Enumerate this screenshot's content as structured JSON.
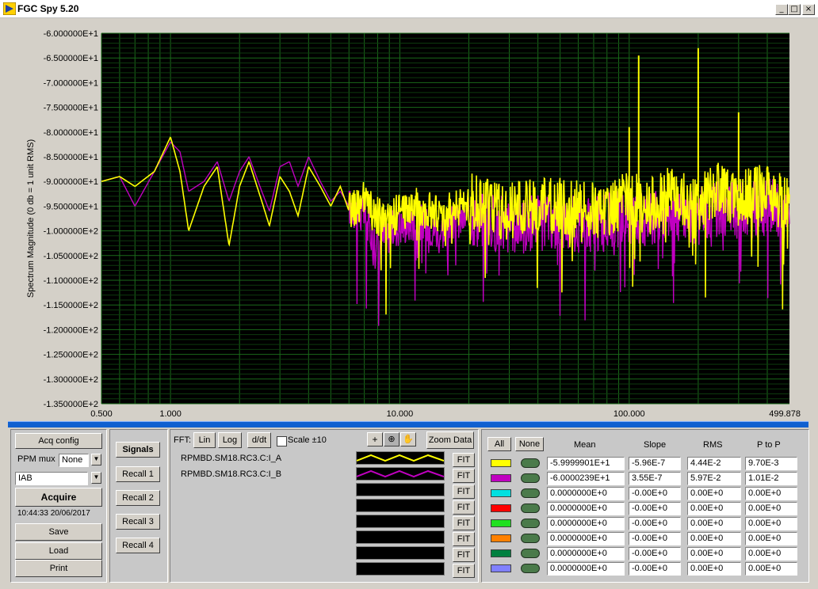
{
  "window": {
    "title": "FGC Spy 5.20",
    "controls": {
      "minimize": "_",
      "maximize": "□",
      "close": "×"
    }
  },
  "plot": {
    "ylabel": "Spectrum Magnitude (0 db = 1 unit RMS)",
    "yticks": [
      "-6.000000E+1",
      "-6.500000E+1",
      "-7.000000E+1",
      "-7.500000E+1",
      "-8.000000E+1",
      "-8.500000E+1",
      "-9.000000E+1",
      "-9.500000E+1",
      "-1.000000E+2",
      "-1.050000E+2",
      "-1.100000E+2",
      "-1.150000E+2",
      "-1.200000E+2",
      "-1.250000E+2",
      "-1.300000E+2",
      "-1.350000E+2"
    ],
    "xticks": [
      "0.500",
      "1.000",
      "10.000",
      "100.000",
      "499.878"
    ],
    "colors": {
      "background": "#000000",
      "grid": "#1a6a1a",
      "series_a": "#ffff00",
      "series_b": "#c000c0"
    }
  },
  "chart_data": {
    "type": "line",
    "xlabel": "",
    "ylabel": "Spectrum Magnitude (0 db = 1 unit RMS)",
    "xscale": "log",
    "xlim": [
      0.5,
      499.878
    ],
    "ylim": [
      -135,
      -60
    ],
    "grid": true,
    "series": [
      {
        "name": "RPMBD.SM18.RC3.C:I_A",
        "color": "#ffff00",
        "x": [
          0.5,
          0.6,
          0.7,
          0.85,
          1.0,
          1.1,
          1.2,
          1.4,
          1.6,
          1.8,
          2.0,
          2.2,
          2.5,
          2.7,
          3.0,
          3.3,
          3.6,
          4.0,
          4.5,
          5.0,
          5.5,
          6.0,
          7.0,
          8.0,
          9.0,
          10,
          12,
          15,
          20,
          30,
          50,
          70,
          100,
          120,
          150,
          200,
          250,
          300,
          400,
          499.878
        ],
        "y": [
          -90,
          -89,
          -91,
          -88,
          -81,
          -88,
          -100,
          -91,
          -87,
          -103,
          -91,
          -86,
          -94,
          -99,
          -89,
          -92,
          -97,
          -87,
          -91,
          -95,
          -91,
          -96,
          -94,
          -97,
          -98,
          -96,
          -95,
          -97,
          -94,
          -96,
          -95,
          -96,
          -94,
          -95,
          -93,
          -94,
          -92,
          -93,
          -92,
          -95
        ]
      },
      {
        "name": "RPMBD.SM18.RC3.C:I_B",
        "color": "#c000c0",
        "x": [
          0.5,
          0.6,
          0.7,
          0.85,
          1.0,
          1.1,
          1.2,
          1.4,
          1.6,
          1.8,
          2.0,
          2.2,
          2.5,
          2.7,
          3.0,
          3.3,
          3.6,
          4.0,
          4.5,
          5.0,
          5.5,
          6.0,
          7.0,
          8.0,
          9.0,
          10,
          12,
          15,
          20,
          30,
          50,
          70,
          100,
          120,
          150,
          200,
          250,
          300,
          400,
          499.878
        ],
        "y": [
          -90,
          -89,
          -95,
          -88,
          -82,
          -84,
          -92,
          -90,
          -86,
          -94,
          -88,
          -85,
          -92,
          -96,
          -87,
          -86,
          -91,
          -85,
          -90,
          -94,
          -92,
          -95,
          -97,
          -103,
          -100,
          -99,
          -98,
          -100,
          -97,
          -99,
          -98,
          -99,
          -97,
          -98,
          -96,
          -97,
          -95,
          -96,
          -95,
          -97
        ]
      }
    ],
    "spikes": [
      {
        "x": 110,
        "y": -64.5
      },
      {
        "x": 100,
        "y": -79
      },
      {
        "x": 200,
        "y": -63
      },
      {
        "x": 300,
        "y": -76
      }
    ]
  },
  "left": {
    "acq_config": "Acq config",
    "ppm_mux_label": "PPM mux",
    "ppm_mux_value": "None",
    "signal_select": "IAB",
    "acquire": "Acquire",
    "timestamp": "10:44:33 20/06/2017",
    "save": "Save",
    "load": "Load",
    "print": "Print"
  },
  "recall": {
    "signals": "Signals",
    "items": [
      "Recall 1",
      "Recall 2",
      "Recall 3",
      "Recall 4"
    ]
  },
  "fft": {
    "label": "FFT:",
    "lin": "Lin",
    "log": "Log",
    "ddt": "d/dt",
    "scale": "Scale ±10",
    "zoom": "Zoom Data"
  },
  "channels": {
    "names": [
      "RPMBD.SM18.RC3.C:I_A",
      "RPMBD.SM18.RC3.C:I_B",
      "",
      "",
      "",
      "",
      "",
      ""
    ],
    "fit": "FIT"
  },
  "stats": {
    "all": "All",
    "none": "None",
    "headers": [
      "Mean",
      "Slope",
      "RMS",
      "P to P"
    ],
    "swatch_colors": [
      "#ffff00",
      "#c000c0",
      "#00e0e0",
      "#ff0000",
      "#20e020",
      "#ff8000",
      "#008040",
      "#8080ff"
    ],
    "rows": [
      [
        "-5.9999901E+1",
        "-5.96E-7",
        "4.44E-2",
        "9.70E-3"
      ],
      [
        "-6.0000239E+1",
        "3.55E-7",
        "5.97E-2",
        "1.01E-2"
      ],
      [
        "0.0000000E+0",
        "-0.00E+0",
        "0.00E+0",
        "0.00E+0"
      ],
      [
        "0.0000000E+0",
        "-0.00E+0",
        "0.00E+0",
        "0.00E+0"
      ],
      [
        "0.0000000E+0",
        "-0.00E+0",
        "0.00E+0",
        "0.00E+0"
      ],
      [
        "0.0000000E+0",
        "-0.00E+0",
        "0.00E+0",
        "0.00E+0"
      ],
      [
        "0.0000000E+0",
        "-0.00E+0",
        "0.00E+0",
        "0.00E+0"
      ],
      [
        "0.0000000E+0",
        "-0.00E+0",
        "0.00E+0",
        "0.00E+0"
      ]
    ]
  }
}
